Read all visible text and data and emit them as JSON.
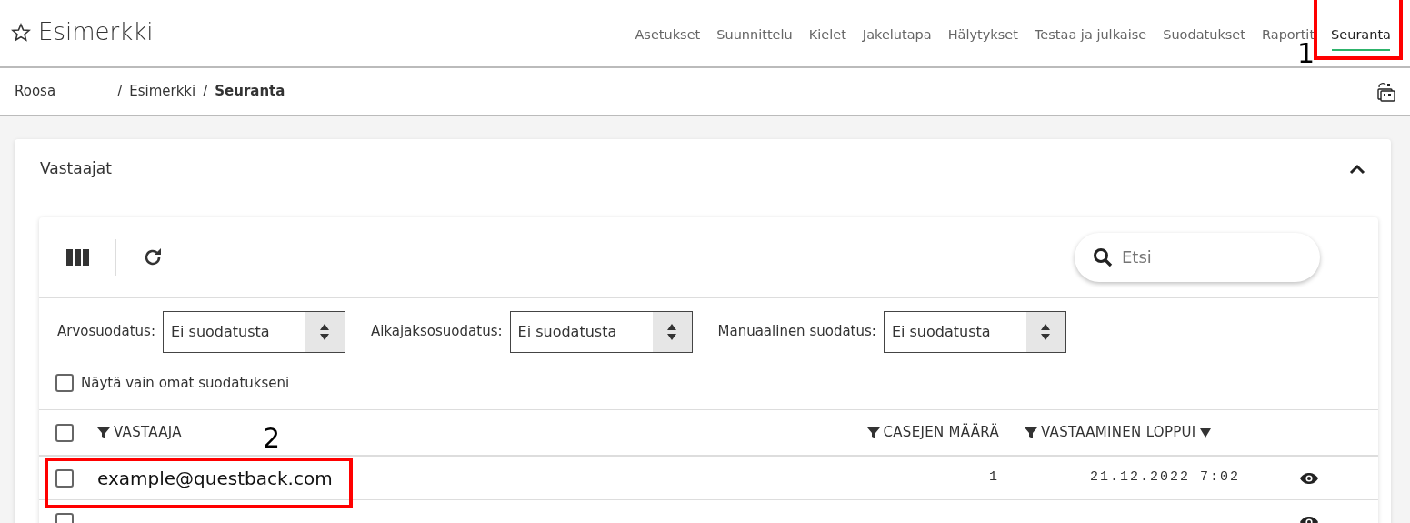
{
  "header": {
    "title": "Esimerkki",
    "favorite": false
  },
  "tabs": [
    {
      "label": "Asetukset",
      "selected": false
    },
    {
      "label": "Suunnittelu",
      "selected": false
    },
    {
      "label": "Kielet",
      "selected": false
    },
    {
      "label": "Jakelutapa",
      "selected": false
    },
    {
      "label": "Hälytykset",
      "selected": false
    },
    {
      "label": "Testaa ja julkaise",
      "selected": false
    },
    {
      "label": "Suodatukset",
      "selected": false
    },
    {
      "label": "Raportit",
      "selected": false
    },
    {
      "label": "Seuranta",
      "selected": true,
      "annotation": "1"
    }
  ],
  "breadcrumb": [
    {
      "label": "Roosa"
    },
    {
      "separator": "/",
      "label": "Esimerkki"
    },
    {
      "separator": "/",
      "label": "Seuranta"
    }
  ],
  "panel": {
    "title": "Vastaajat",
    "expanded": true
  },
  "search": {
    "placeholder": "Etsi"
  },
  "filters": [
    {
      "label": "Arvosuodatus:",
      "value": "Ei suodatusta"
    },
    {
      "label": "Aikajaksosuodatus:",
      "value": "Ei suodatusta"
    },
    {
      "label": "Manuaalinen suodatus:",
      "value": "Ei suodatusta"
    }
  ],
  "own_filters": {
    "label": "Näytä vain omat suodatukseni",
    "checked": false
  },
  "table": {
    "all_checked": false,
    "columns": [
      {
        "label": "VASTAAJA",
        "sorted": false
      },
      {
        "label": "CASEJEN MÄÄRÄ",
        "sorted": false
      },
      {
        "label": "VASTAAMINEN LOPPUI",
        "sorted": true
      }
    ],
    "rows": [
      {
        "checked": false,
        "respondent": "example@questback.com",
        "cases": "1",
        "ended": "21.12.2022 7:02",
        "annotation": "2"
      },
      {
        "checked": false
      }
    ]
  }
}
